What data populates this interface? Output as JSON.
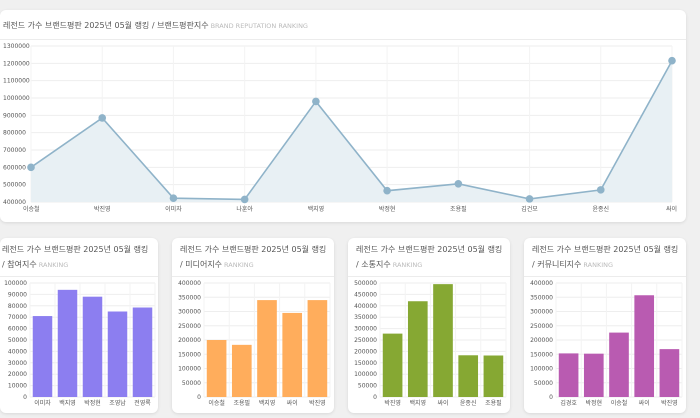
{
  "main": {
    "title": "레전드 가수 브랜드평판 2025년 05월 랭킹 / 브랜드평판지수",
    "subtitle": "BRAND REPUTATION RANKING"
  },
  "panels": [
    {
      "title": "레전드 가수 브랜드평판 2025년 05월 랭킹 / 참여지수",
      "subtitle": "RANKING"
    },
    {
      "title": "레전드 가수 브랜드평판 2025년 05월 랭킹 / 미디어지수",
      "subtitle": "RANKING"
    },
    {
      "title": "레전드 가수 브랜드평판 2025년 05월 랭킹 / 소통지수",
      "subtitle": "RANKING"
    },
    {
      "title": "레전드 가수 브랜드평판 2025년 05월 랭킹 / 커뮤니티지수",
      "subtitle": "RANKING"
    }
  ],
  "colors": {
    "line": "#8fb3c9",
    "area": "#e8f0f4",
    "point": "#8fb3c9",
    "participation": "#8c7ef0",
    "media": "#ffad5c",
    "communication": "#86a833",
    "community": "#b95bb1"
  },
  "chart_data": [
    {
      "type": "area",
      "title": "레전드 가수 브랜드평판 2025년 05월 랭킹 / 브랜드평판지수",
      "categories": [
        "이승철",
        "박진영",
        "이미자",
        "나훈아",
        "백지영",
        "박정현",
        "조용필",
        "김건모",
        "윤종신",
        "싸이"
      ],
      "values": [
        600000,
        885000,
        422000,
        415000,
        980000,
        465000,
        505000,
        418000,
        470000,
        1215000
      ],
      "ylim": [
        400000,
        1300000
      ],
      "yticks": [
        400000,
        500000,
        600000,
        700000,
        800000,
        900000,
        1000000,
        1100000,
        1200000,
        1300000
      ],
      "grid": true
    },
    {
      "type": "bar",
      "title": "레전드 가수 브랜드평판 2025년 05월 랭킹 / 참여지수",
      "categories": [
        "이미자",
        "백지영",
        "박정현",
        "조영남",
        "전영록"
      ],
      "values": [
        71000,
        94000,
        88000,
        75000,
        78500
      ],
      "ylim": [
        0,
        100000
      ],
      "yticks": [
        0,
        10000,
        20000,
        30000,
        40000,
        50000,
        60000,
        70000,
        80000,
        90000,
        100000
      ],
      "grid": true
    },
    {
      "type": "bar",
      "title": "레전드 가수 브랜드평판 2025년 05월 랭킹 / 미디어지수",
      "categories": [
        "이승철",
        "조용필",
        "백지영",
        "싸이",
        "박진영"
      ],
      "values": [
        200000,
        183000,
        340000,
        295000,
        340000
      ],
      "ylim": [
        0,
        400000
      ],
      "yticks": [
        0,
        50000,
        100000,
        150000,
        200000,
        250000,
        300000,
        350000,
        400000
      ],
      "grid": true
    },
    {
      "type": "bar",
      "title": "레전드 가수 브랜드평판 2025년 05월 랭킹 / 소통지수",
      "categories": [
        "박진영",
        "백지영",
        "싸이",
        "윤종신",
        "조용필"
      ],
      "values": [
        278000,
        420000,
        495000,
        183000,
        182000
      ],
      "ylim": [
        0,
        500000
      ],
      "yticks": [
        0,
        50000,
        100000,
        150000,
        200000,
        250000,
        300000,
        350000,
        400000,
        450000,
        500000
      ],
      "grid": true
    },
    {
      "type": "bar",
      "title": "레전드 가수 브랜드평판 2025년 05월 랭킹 / 커뮤니티지수",
      "categories": [
        "김경호",
        "박정현",
        "이승철",
        "싸이",
        "박진영"
      ],
      "values": [
        153000,
        152000,
        226000,
        357000,
        168000
      ],
      "ylim": [
        0,
        400000
      ],
      "yticks": [
        0,
        50000,
        100000,
        150000,
        200000,
        250000,
        300000,
        350000,
        400000
      ],
      "grid": true
    }
  ]
}
